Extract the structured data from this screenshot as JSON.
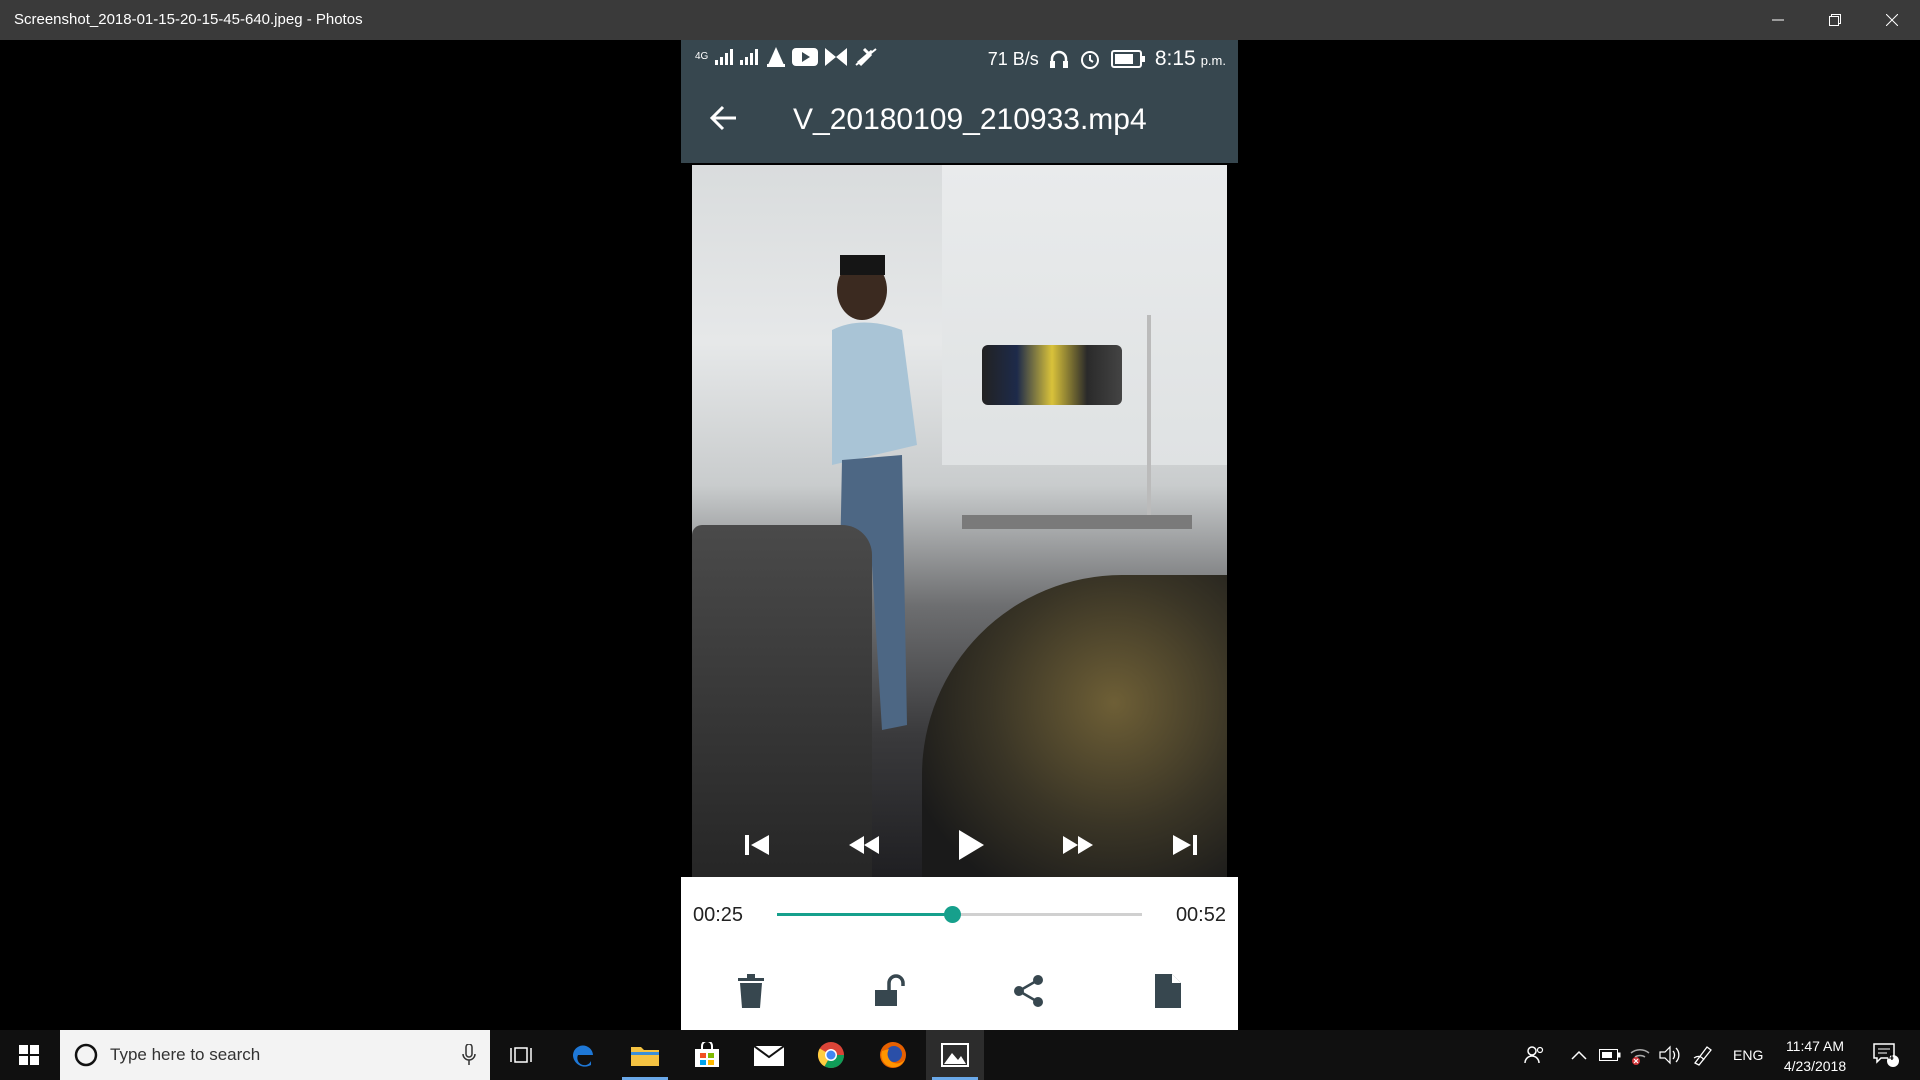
{
  "window": {
    "title": "Screenshot_2018-01-15-20-15-45-640.jpeg - Photos"
  },
  "phone": {
    "status": {
      "icons": [
        "4g-icon",
        "signal-icon",
        "signal-2-icon",
        "vlc-icon",
        "youtube-icon",
        "m-icon",
        "no-bluetooth-icon"
      ],
      "speed": "71 B/s",
      "time": "8:15",
      "ampm": "p.m."
    },
    "appbar": {
      "title": "V_20180109_210933.mp4"
    },
    "player": {
      "current": "00:25",
      "total": "00:52",
      "progress": 0.48
    }
  },
  "taskbar": {
    "search_placeholder": "Type here to search",
    "language": "ENG",
    "clock_time": "11:47 AM",
    "clock_date": "4/23/2018",
    "notification_count": "4"
  }
}
